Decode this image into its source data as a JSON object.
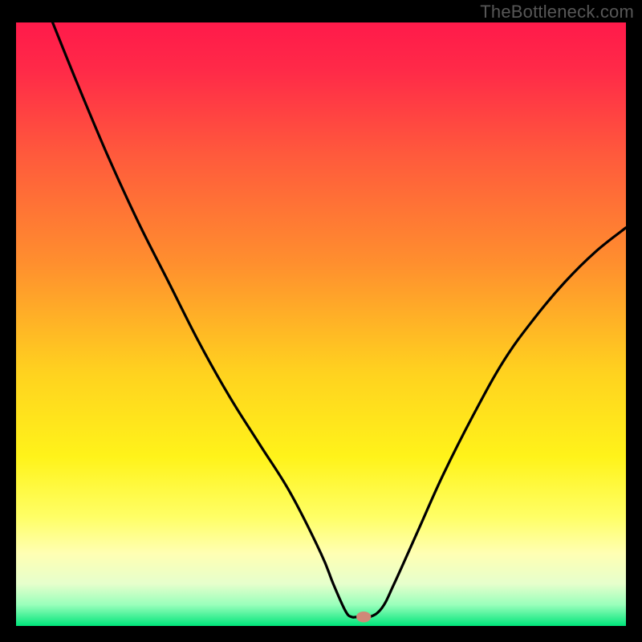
{
  "watermark": "TheBottleneck.com",
  "chart_data": {
    "type": "line",
    "title": "",
    "xlabel": "",
    "ylabel": "",
    "xlim": [
      0,
      100
    ],
    "ylim": [
      0,
      100
    ],
    "grid": false,
    "legend": false,
    "background_gradient": {
      "stops": [
        {
          "offset": 0.0,
          "color": "#ff1a4a"
        },
        {
          "offset": 0.08,
          "color": "#ff2a48"
        },
        {
          "offset": 0.22,
          "color": "#ff5a3c"
        },
        {
          "offset": 0.4,
          "color": "#ff8f2e"
        },
        {
          "offset": 0.58,
          "color": "#ffd21f"
        },
        {
          "offset": 0.72,
          "color": "#fff31a"
        },
        {
          "offset": 0.82,
          "color": "#ffff66"
        },
        {
          "offset": 0.88,
          "color": "#ffffb3"
        },
        {
          "offset": 0.93,
          "color": "#e6ffcc"
        },
        {
          "offset": 0.965,
          "color": "#99ffbb"
        },
        {
          "offset": 1.0,
          "color": "#00e57a"
        }
      ]
    },
    "series": [
      {
        "name": "bottleneck-curve",
        "color": "#000000",
        "x": [
          6,
          10,
          15,
          20,
          25,
          30,
          35,
          40,
          45,
          50,
          52,
          54,
          55,
          56,
          58,
          60,
          62,
          66,
          70,
          75,
          80,
          85,
          90,
          95,
          100
        ],
        "y": [
          100,
          90,
          78,
          67,
          57,
          47,
          38,
          30,
          22,
          12,
          7,
          2.5,
          1.5,
          1.5,
          1.5,
          3,
          7,
          16,
          25,
          35,
          44,
          51,
          57,
          62,
          66
        ]
      }
    ],
    "marker": {
      "name": "min-point",
      "x": 57,
      "y": 1.5,
      "color": "#d08878",
      "rx": 1.2,
      "ry": 0.9
    }
  }
}
